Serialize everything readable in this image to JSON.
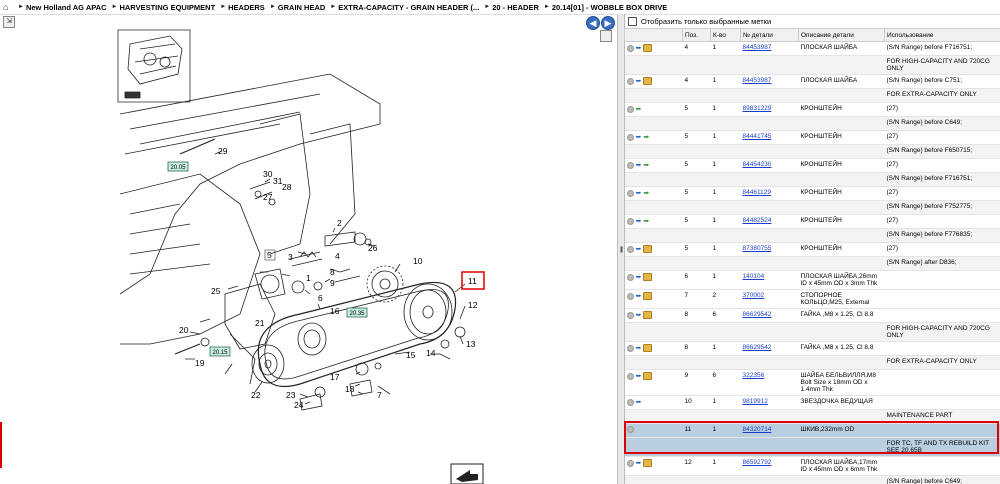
{
  "breadcrumb": [
    "New Holland AG APAC",
    "HARVESTING EQUIPMENT",
    "HEADERS",
    "GRAIN HEAD",
    "EXTRA-CAPACITY - GRAIN HEADER (...",
    "20 - HEADER",
    "20.14[01] - WOBBLE BOX DRIVE"
  ],
  "icons": {
    "home": "home-icon",
    "back": "arrow-left-icon",
    "forward": "arrow-right-icon"
  },
  "filter_label": "Отобразить только выбранные метки",
  "columns": [
    "Поз.",
    "К-во",
    "№ детали",
    "Описание детали",
    "Использование"
  ],
  "callouts": [
    "29",
    "30",
    "31",
    "28",
    "27",
    "26",
    "25",
    "2",
    "3",
    "5",
    "4",
    "8",
    "9",
    "10",
    "11",
    "6",
    "16",
    "12",
    "13",
    "14",
    "15",
    "7",
    "17",
    "18",
    "19",
    "20",
    "21",
    "22",
    "23",
    "24",
    "1"
  ],
  "hotspots": [
    "20.05",
    "20.35",
    "20.15"
  ],
  "rows": [
    {
      "pos": "4",
      "qty": "1",
      "part": "84453987",
      "desc": "ПЛОСКАЯ ШАЙБА",
      "use": [
        "(S/N Range) before F716751;",
        "FOR HIGH-CAPACITY AND 720CG ONLY"
      ],
      "icons": [
        "g",
        "b",
        "p"
      ]
    },
    {
      "pos": "4",
      "qty": "1",
      "part": "84453987",
      "desc": "ПЛОСКАЯ ШАЙБА",
      "use": [
        "(S/N Range) before C751;",
        "FOR EXTRA-CAPACITY ONLY"
      ],
      "icons": [
        "g",
        "b",
        "p"
      ]
    },
    {
      "pos": "5",
      "qty": "1",
      "part": "89831229",
      "desc": "КРОНШТЕЙН",
      "use": [
        "(27)",
        "(S/N Range) before C649;"
      ],
      "icons": [
        "g",
        "a"
      ]
    },
    {
      "pos": "5",
      "qty": "1",
      "part": "84441745",
      "desc": "КРОНШТЕЙН",
      "use": [
        "(27)",
        "(S/N Range) before F650715;"
      ],
      "icons": [
        "g",
        "b",
        "a"
      ]
    },
    {
      "pos": "5",
      "qty": "1",
      "part": "84454230",
      "desc": "КРОНШТЕЙН",
      "use": [
        "(27)",
        "(S/N Range) before F716751;"
      ],
      "icons": [
        "g",
        "b",
        "a"
      ]
    },
    {
      "pos": "5",
      "qty": "1",
      "part": "84461129",
      "desc": "КРОНШТЕЙН",
      "use": [
        "(27)",
        "(S/N Range) before F752775;"
      ],
      "icons": [
        "g",
        "b",
        "a"
      ]
    },
    {
      "pos": "5",
      "qty": "1",
      "part": "84482524",
      "desc": "КРОНШТЕЙН",
      "use": [
        "(27)",
        "(S/N Range) before F776835;"
      ],
      "icons": [
        "g",
        "b",
        "a"
      ]
    },
    {
      "pos": "5",
      "qty": "1",
      "part": "87380755",
      "desc": "КРОНШТЕЙН",
      "use": [
        "(27)",
        "(S/N Range) after D836;"
      ],
      "icons": [
        "g",
        "b",
        "p"
      ]
    },
    {
      "pos": "6",
      "qty": "1",
      "part": "140104",
      "desc": "ПЛОСКАЯ ШАЙБА,26mm ID x 45mm OD x 3mm Thk",
      "use": [],
      "icons": [
        "g",
        "b",
        "p"
      ]
    },
    {
      "pos": "7",
      "qty": "2",
      "part": "370002",
      "desc": "СТОПОРНОЕ КОЛЬЦО,M25, External",
      "use": [],
      "icons": [
        "g",
        "b",
        "p"
      ]
    },
    {
      "pos": "8",
      "qty": "6",
      "part": "86629542",
      "desc": "ГАЙКА ,M8 x 1.25, Cl 8.8",
      "use": [
        "",
        "FOR HIGH-CAPACITY AND 720CG ONLY"
      ],
      "icons": [
        "g",
        "b",
        "p"
      ]
    },
    {
      "pos": "8",
      "qty": "1",
      "part": "86629542",
      "desc": "ГАЙКА ,M8 x 1.25, Cl 8.8",
      "use": [
        "",
        "FOR EXTRA-CAPACITY ONLY"
      ],
      "icons": [
        "g",
        "b",
        "p"
      ]
    },
    {
      "pos": "9",
      "qty": "6",
      "part": "322356",
      "desc": "ШАЙБА БЕЛЬВИЛЛЯ,M8 Bolt Size x 18mm OD x 1.4mm Thk",
      "use": [],
      "icons": [
        "g",
        "b",
        "p"
      ]
    },
    {
      "pos": "10",
      "qty": "1",
      "part": "9819912",
      "desc": "ЗВЕЗДОЧКА ВЕДУЩАЯ",
      "use": [
        "",
        "MAINTENANCE PART"
      ],
      "icons": [
        "g",
        "b"
      ]
    },
    {
      "pos": "11",
      "qty": "1",
      "part": "84320714",
      "desc": "ШКИВ,232mm OD",
      "use": [
        "",
        "FOR TC, TF AND TX REBUILD KIT SEE 20.65B"
      ],
      "icons": [
        "g"
      ],
      "selected": true
    },
    {
      "pos": "12",
      "qty": "1",
      "part": "86592792",
      "desc": "ПЛОСКАЯ ШАЙБА,17mm ID x 45mm OD x 6mm Thk",
      "use": [
        "",
        "(S/N Range) before C649;"
      ],
      "icons": [
        "g",
        "b",
        "p"
      ]
    }
  ]
}
